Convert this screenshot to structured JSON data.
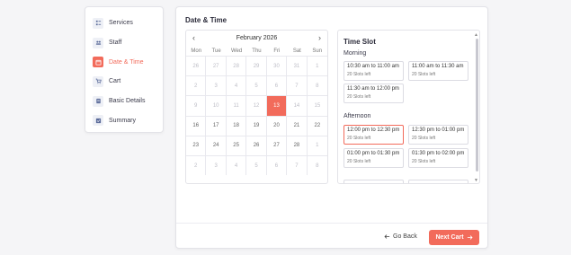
{
  "sidebar": {
    "items": [
      {
        "label": "Services",
        "icon": "services-icon",
        "active": false
      },
      {
        "label": "Staff",
        "icon": "staff-icon",
        "active": false
      },
      {
        "label": "Date & Time",
        "icon": "calendar-icon",
        "active": true
      },
      {
        "label": "Cart",
        "icon": "cart-icon",
        "active": false
      },
      {
        "label": "Basic Details",
        "icon": "details-icon",
        "active": false
      },
      {
        "label": "Summary",
        "icon": "summary-icon",
        "active": false
      }
    ]
  },
  "main": {
    "title": "Date & Time"
  },
  "calendar": {
    "month_label": "February 2026",
    "prev_icon": "chevron-left-icon",
    "next_icon": "chevron-right-icon",
    "weekdays": [
      "Mon",
      "Tue",
      "Wed",
      "Thu",
      "Fri",
      "Sat",
      "Sun"
    ],
    "weeks": [
      [
        "26",
        "27",
        "28",
        "29",
        "30",
        "31",
        "1"
      ],
      [
        "2",
        "3",
        "4",
        "5",
        "6",
        "7",
        "8"
      ],
      [
        "9",
        "10",
        "11",
        "12",
        "13",
        "14",
        "15"
      ],
      [
        "16",
        "17",
        "18",
        "19",
        "20",
        "21",
        "22"
      ],
      [
        "23",
        "24",
        "25",
        "26",
        "27",
        "28",
        "1"
      ],
      [
        "2",
        "3",
        "4",
        "5",
        "6",
        "7",
        "8"
      ]
    ],
    "selected": "13"
  },
  "timeslots": {
    "title": "Time Slot",
    "morning_label": "Morning",
    "afternoon_label": "Afternoon",
    "morning": [
      {
        "time": "10:30 am to 11:00 am",
        "left": "20 Slots left"
      },
      {
        "time": "11:00 am to 11:30 am",
        "left": "20 Slots left"
      },
      {
        "time": "11:30 am to 12:00 pm",
        "left": "20 Slots left"
      }
    ],
    "afternoon": [
      {
        "time": "12:00 pm to 12:30 pm",
        "left": "20 Slots left"
      },
      {
        "time": "12:30 pm to 01:00 pm",
        "left": "20 Slots left"
      },
      {
        "time": "01:00 pm to 01:30 pm",
        "left": "20 Slots left"
      },
      {
        "time": "01:30 pm to 02:00 pm",
        "left": "20 Slots left"
      }
    ],
    "selected": "12:00 pm to 12:30 pm"
  },
  "footer": {
    "back_label": "Go Back",
    "next_label": "Next Cart"
  },
  "colors": {
    "accent": "#f26b5b",
    "border": "#e3e3e8",
    "muted_text": "#bdbdc6"
  }
}
